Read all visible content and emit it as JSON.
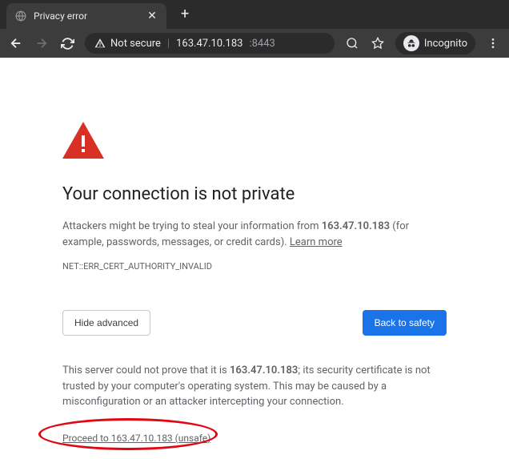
{
  "tab": {
    "title": "Privacy error"
  },
  "omnibox": {
    "not_secure": "Not secure",
    "host": "163.47.10.183",
    "port": ":8443"
  },
  "incognito": {
    "label": "Incognito"
  },
  "page": {
    "heading": "Your connection is not private",
    "desc_prefix": "Attackers might be trying to steal your information from ",
    "desc_host": "163.47.10.183",
    "desc_suffix": " (for example, passwords, messages, or credit cards). ",
    "learn_more": "Learn more",
    "error_code": "NET::ERR_CERT_AUTHORITY_INVALID",
    "hide_advanced": "Hide advanced",
    "back_to_safety": "Back to safety",
    "adv_prefix": "This server could not prove that it is ",
    "adv_host": "163.47.10.183",
    "adv_suffix": "; its security certificate is not trusted by your computer's operating system. This may be caused by a misconfiguration or an attacker intercepting your connection.",
    "proceed": "Proceed to 163.47.10.183 (unsafe)"
  }
}
